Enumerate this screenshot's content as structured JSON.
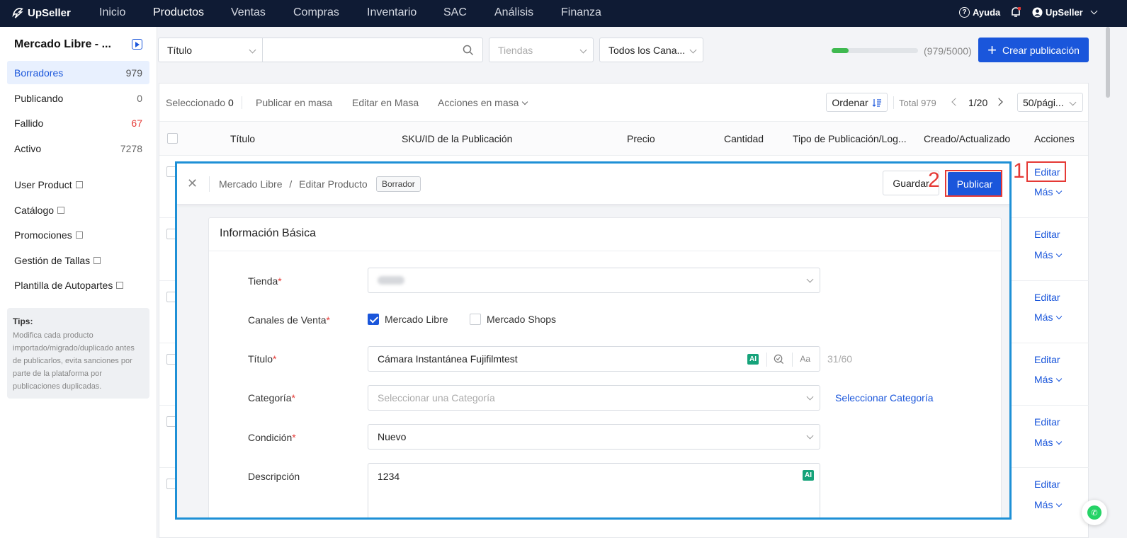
{
  "topnav": {
    "brand": "UpSeller",
    "items": [
      "Inicio",
      "Productos",
      "Ventas",
      "Compras",
      "Inventario",
      "SAC",
      "Análisis",
      "Finanza"
    ],
    "active": "Productos",
    "help": "Ayuda",
    "user": "UpSeller"
  },
  "sidebar": {
    "title": "Mercado Libre - ...",
    "statuses": [
      {
        "label": "Borradores",
        "count": "979"
      },
      {
        "label": "Publicando",
        "count": "0"
      },
      {
        "label": "Fallido",
        "count": "67"
      },
      {
        "label": "Activo",
        "count": "7278"
      }
    ],
    "links": [
      "User Product",
      "Catálogo",
      "Promociones",
      "Gestión de Tallas",
      "Plantilla de Autopartes"
    ],
    "tips_title": "Tips:",
    "tips_text": "Modifica cada producto importado/migrado/duplicado antes de publicarlos, evita sanciones por parte de la plataforma por publicaciones duplicadas."
  },
  "filters": {
    "field": "Título",
    "search_placeholder": "",
    "store_placeholder": "Tiendas",
    "channel": "Todos los Cana...",
    "quota_text": "(979/5000)",
    "quota_fraction": 0.196,
    "create_button": "Crear publicación"
  },
  "toolbar": {
    "selected_label": "Seleccionado",
    "selected_count": "0",
    "bulk_publish": "Publicar en masa",
    "bulk_edit": "Editar en Masa",
    "bulk_actions": "Acciones en masa",
    "sort": "Ordenar",
    "total": "Total 979",
    "page": "1/20",
    "page_size": "50/pági..."
  },
  "table": {
    "columns": [
      "Título",
      "SKU/ID de la Publicación",
      "Precio",
      "Cantidad",
      "Tipo de Publicación/Log...",
      "Creado/Actualizado",
      "Acciones"
    ],
    "row_actions": {
      "edit": "Editar",
      "more": "Más"
    }
  },
  "annotations": {
    "step1": "1",
    "step2": "2"
  },
  "modal": {
    "breadcrumb_root": "Mercado Libre",
    "breadcrumb_sep": "/",
    "breadcrumb_page": "Editar Producto",
    "status_tag": "Borrador",
    "save_button": "Guardar",
    "publish_button": "Publicar",
    "section_title": "Información Básica",
    "fields": {
      "store_label": "Tienda",
      "channels_label": "Canales de Venta",
      "channel_ml": "Mercado Libre",
      "channel_ms": "Mercado Shops",
      "title_label": "Título",
      "title_value": "Cámara Instantánea Fujifilmtest",
      "title_counter": "31/60",
      "ai_badge": "AI",
      "case_icon_text": "Aa",
      "category_label": "Categoría",
      "category_placeholder": "Seleccionar una Categoría",
      "category_link": "Seleccionar Categoría",
      "condition_label": "Condición",
      "condition_value": "Nuevo",
      "description_label": "Descripción",
      "description_value": "1234"
    }
  }
}
